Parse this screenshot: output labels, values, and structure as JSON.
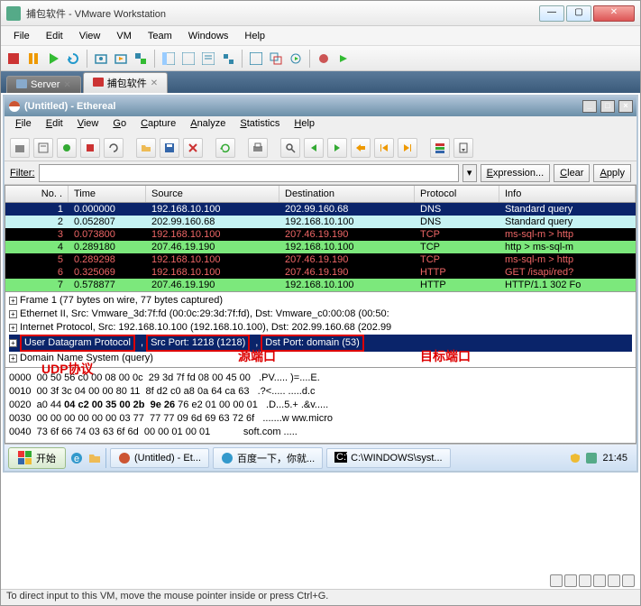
{
  "outer_window": {
    "title": "捕包软件 - VMware Workstation",
    "menu": [
      "File",
      "Edit",
      "View",
      "VM",
      "Team",
      "Windows",
      "Help"
    ]
  },
  "tabs": {
    "server": "Server",
    "active": "捕包软件"
  },
  "ethereal": {
    "title": "(Untitled) - Ethereal",
    "menu": {
      "file": "File",
      "edit": "Edit",
      "view": "View",
      "go": "Go",
      "capture": "Capture",
      "analyze": "Analyze",
      "statistics": "Statistics",
      "help": "Help"
    },
    "filter": {
      "label": "Filter:",
      "value": "",
      "expression": "Expression...",
      "clear": "Clear",
      "apply": "Apply"
    },
    "columns": {
      "no": "No. .",
      "time": "Time",
      "source": "Source",
      "dest": "Destination",
      "proto": "Protocol",
      "info": "Info"
    },
    "rows": [
      {
        "no": "1",
        "time": "0.000000",
        "src": "192.168.10.100",
        "dst": "202.99.160.68",
        "proto": "DNS",
        "info": "Standard query",
        "cls": "r-sel"
      },
      {
        "no": "2",
        "time": "0.052807",
        "src": "202.99.160.68",
        "dst": "192.168.10.100",
        "proto": "DNS",
        "info": "Standard query",
        "cls": "r-cyan"
      },
      {
        "no": "3",
        "time": "0.073800",
        "src": "192.168.10.100",
        "dst": "207.46.19.190",
        "proto": "TCP",
        "info": "ms-sql-m > http",
        "cls": "r-red"
      },
      {
        "no": "4",
        "time": "0.289180",
        "src": "207.46.19.190",
        "dst": "192.168.10.100",
        "proto": "TCP",
        "info": "http > ms-sql-m",
        "cls": "r-green"
      },
      {
        "no": "5",
        "time": "0.289298",
        "src": "192.168.10.100",
        "dst": "207.46.19.190",
        "proto": "TCP",
        "info": "ms-sql-m > http",
        "cls": "r-red"
      },
      {
        "no": "6",
        "time": "0.325069",
        "src": "192.168.10.100",
        "dst": "207.46.19.190",
        "proto": "HTTP",
        "info": "GET /isapi/red?",
        "cls": "r-red"
      },
      {
        "no": "7",
        "time": "0.578877",
        "src": "207.46.19.190",
        "dst": "192.168.10.100",
        "proto": "HTTP",
        "info": "HTTP/1.1 302 Fo",
        "cls": "r-green"
      }
    ],
    "details": {
      "frame": "Frame 1 (77 bytes on wire, 77 bytes captured)",
      "eth": "Ethernet II, Src: Vmware_3d:7f:fd (00:0c:29:3d:7f:fd), Dst: Vmware_c0:00:08 (00:50:",
      "ip": "Internet Protocol, Src: 192.168.10.100 (192.168.10.100), Dst: 202.99.160.68 (202.99",
      "udp_proto": "User Datagram Protocol",
      "udp_src": "Src Port: 1218 (1218)",
      "udp_dst": "Dst Port: domain (53)",
      "dns": "Domain Name System (query)"
    },
    "hex": {
      "l0": "0000  00 50 56 c0 00 08 00 0c  29 3d 7f fd 08 00 45 00   .PV..... )=....E.",
      "l1": "0010  00 3f 3c 04 00 00 80 11  8f d2 c0 a8 0a 64 ca 63   .?<..... .....d.c",
      "l2a": "0020  a0 44 ",
      "l2b": "04 c2 00 35 00 2b  9e 26",
      "l2c": " 76 e2 01 00 00 01   .D...5.+ .&v.....",
      "l3": "0030  00 00 00 00 00 00 03 77  77 77 09 6d 69 63 72 6f   .......w ww.micro",
      "l4": "0040  73 6f 66 74 03 63 6f 6d  00 00 01 00 01            soft.com ....."
    }
  },
  "annotations": {
    "udp": "UDP协议",
    "src": "源端口",
    "dst": "目标端口"
  },
  "taskbar": {
    "start": "开始",
    "app1": "(Untitled) - Et...",
    "app2": "百度一下，你就...",
    "app3": "C:\\WINDOWS\\syst...",
    "clock": "21:45"
  },
  "status": "To direct input to this VM, move the mouse pointer inside or press Ctrl+G."
}
